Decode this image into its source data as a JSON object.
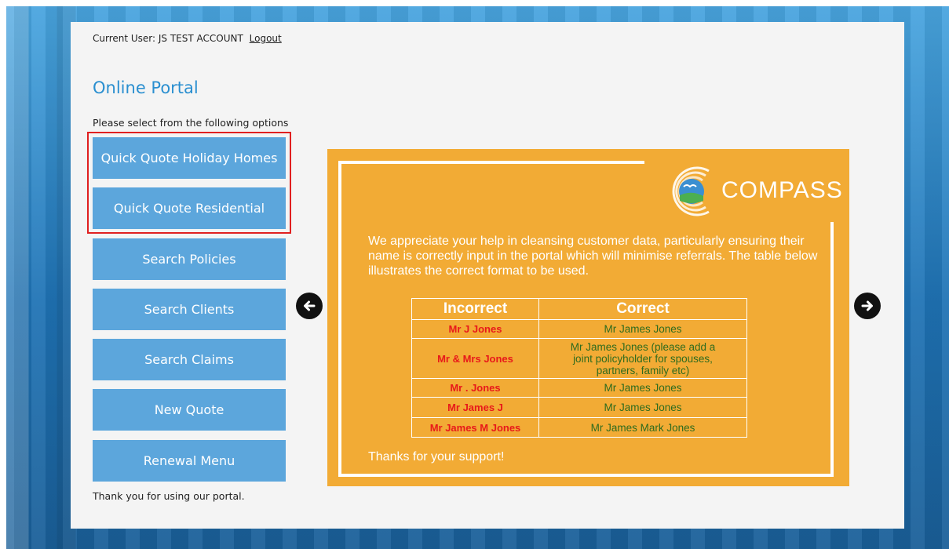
{
  "header": {
    "current_user_label": "Current User: JS TEST ACCOUNT",
    "logout_label": "Logout"
  },
  "page": {
    "title": "Online Portal",
    "instructions": "Please select from the following options",
    "footer_text": "Thank you for using our portal."
  },
  "menu": {
    "items": [
      {
        "label": "Quick Quote Holiday Homes"
      },
      {
        "label": "Quick Quote Residential"
      },
      {
        "label": "Search Policies"
      },
      {
        "label": "Search Clients"
      },
      {
        "label": "Search Claims"
      },
      {
        "label": "New Quote"
      },
      {
        "label": "Renewal Menu"
      }
    ]
  },
  "carousel": {
    "prev_icon": "arrow-left-circle-icon",
    "next_icon": "arrow-right-circle-icon"
  },
  "banner": {
    "logo_text": "COMPASS",
    "message": "We appreciate your help in cleansing customer data, particularly ensuring their name is correctly input in the portal which will minimise referrals. The table below illustrates the correct format to be used.",
    "table": {
      "headers": [
        "Incorrect",
        "Correct"
      ],
      "rows": [
        {
          "incorrect": "Mr J Jones",
          "correct": "Mr James Jones"
        },
        {
          "incorrect": "Mr & Mrs Jones",
          "correct": "Mr James Jones (please add a joint policyholder for spouses, partners, family etc)"
        },
        {
          "incorrect": "Mr . Jones",
          "correct": "Mr James Jones"
        },
        {
          "incorrect": "Mr James J",
          "correct": "Mr James Jones"
        },
        {
          "incorrect": "Mr James M Jones",
          "correct": "Mr James Mark Jones"
        }
      ]
    },
    "thanks": "Thanks for your support!"
  },
  "colors": {
    "accent_title": "#2a8fd0",
    "menu_button": "#5ca6dc",
    "banner_bg": "#f2ab35",
    "highlight_border": "#e02020"
  }
}
